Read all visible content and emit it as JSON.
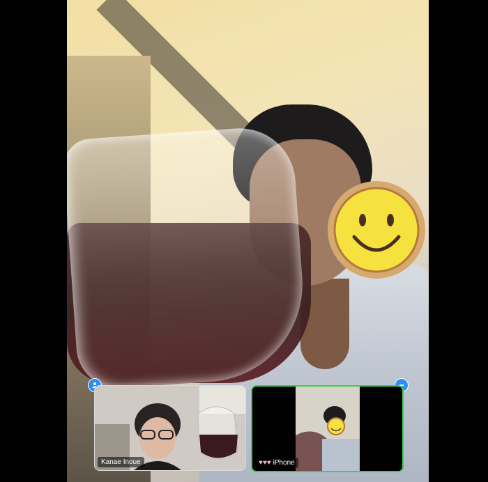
{
  "participants": [
    {
      "name": "Kanae Inoue"
    },
    {
      "name": "iPhone"
    }
  ],
  "icons": {
    "main_face_cover": "smiley-face-icon",
    "thumb_face_cover": "smiley-face-icon",
    "top_left_control": "person-icon",
    "top_right_control": "minus-icon",
    "name_prefix": "heart-icons"
  },
  "colors": {
    "active_speaker_border": "#3ecf4b",
    "control_blue": "#2f8ef2"
  }
}
